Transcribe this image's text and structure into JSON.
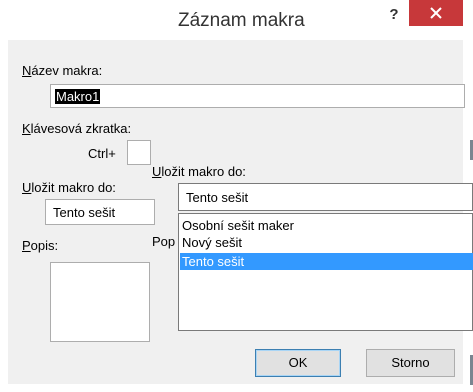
{
  "dialog": {
    "title": "Záznam makra",
    "help_label": "?"
  },
  "macro_name": {
    "label_u": "N",
    "label_rest": "ázev makra:",
    "value": "Makro1"
  },
  "shortcut": {
    "label_u": "K",
    "label_rest": "lávesová zkratka:",
    "prefix": "Ctrl+",
    "value": ""
  },
  "store_in_back": {
    "label_u": "U",
    "label_rest": "ložit makro do:",
    "value": "Tento sešit"
  },
  "store_in_front": {
    "label_u": "U",
    "label_rest": "ložit makro do:",
    "value": "Tento sešit",
    "options": [
      "Osobní sešit maker",
      "Nový sešit",
      "Tento sešit"
    ],
    "selected_index": 2
  },
  "description": {
    "label_u": "P",
    "label_rest": "opis:",
    "overlap_label": "Pop"
  },
  "buttons": {
    "ok": "OK",
    "cancel": "Storno"
  },
  "colors": {
    "close_bg": "#c7383a",
    "selection_bg": "#3399ff"
  }
}
